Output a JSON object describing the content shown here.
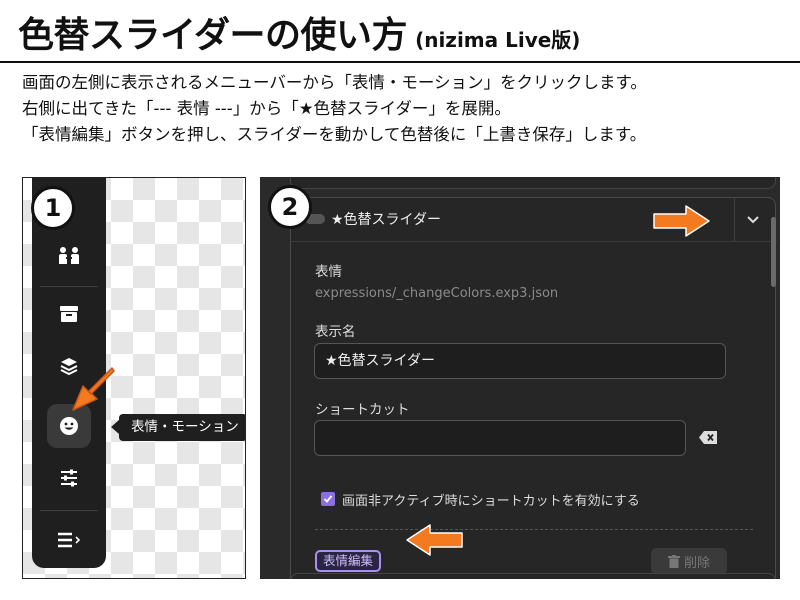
{
  "title": {
    "main": "色替スライダーの使い方",
    "sub": "(nizima Live版)"
  },
  "instructions": [
    "画面の左側に表示されるメニューバーから「表情・モーション」をクリックします。",
    "右側に出てきた「---  表情  ---」から「★色替スライダー」を展開。",
    "「表情編集」ボタンを押し、スライダーを動かして色替後に「上書き保存」します。"
  ],
  "panel1": {
    "step": "1",
    "toolbar_icons": [
      "people-icon",
      "box-icon",
      "layers-icon",
      "face-icon",
      "sliders-icon",
      "menu-icon"
    ],
    "tooltip": "表情・モーション"
  },
  "panel2": {
    "step": "2",
    "item_title": "★色替スライダー",
    "expression_label": "表情",
    "expression_path": "expressions/_changeColors.exp3.json",
    "display_name_label": "表示名",
    "display_name_value": "★色替スライダー",
    "shortcut_label": "ショートカット",
    "shortcut_value": "",
    "checkbox_label": "画面非アクティブ時にショートカットを有効にする",
    "checkbox_checked": true,
    "edit_button": "表情編集",
    "delete_button": "削除"
  },
  "colors": {
    "accent_orange": "#f47a1f",
    "accent_purple": "#a991f2",
    "panel_dark": "#2a2a2a"
  }
}
